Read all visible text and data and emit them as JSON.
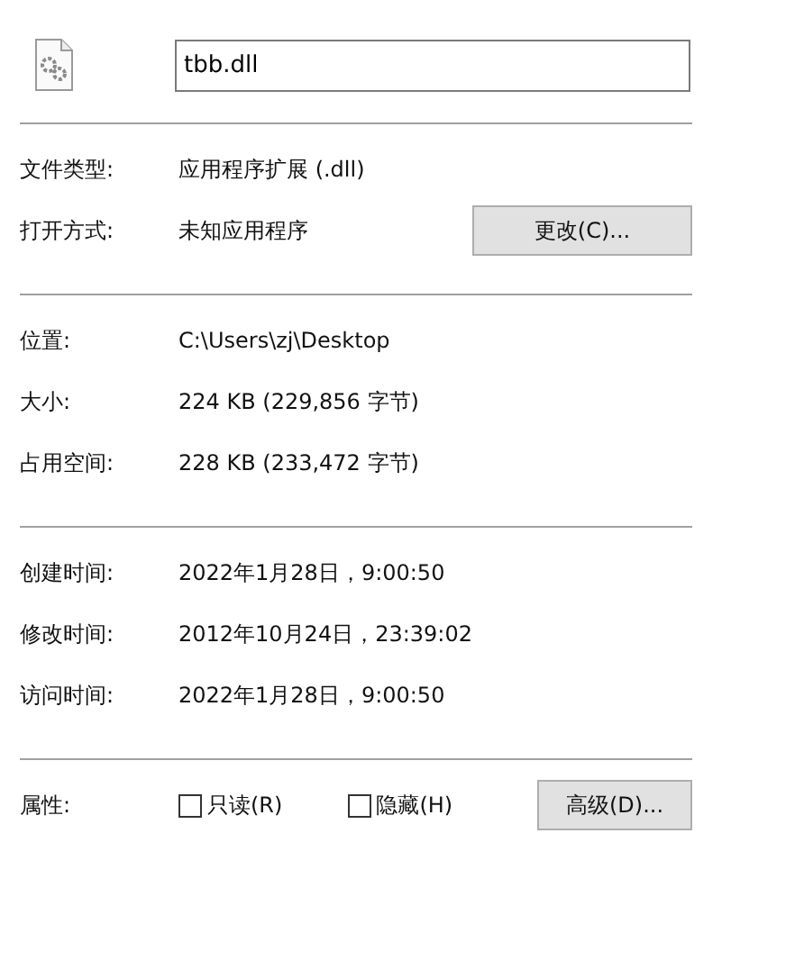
{
  "file_name": "tbb.dll",
  "type_rows": [
    {
      "label": "文件类型:",
      "value": "应用程序扩展 (.dll)"
    },
    {
      "label": "打开方式:",
      "value": "未知应用程序",
      "button": "更改(C)..."
    }
  ],
  "location_rows": [
    {
      "label": "位置:",
      "value": "C:\\Users\\zj\\Desktop"
    },
    {
      "label": "大小:",
      "value": "224 KB (229,856 字节)"
    },
    {
      "label": "占用空间:",
      "value": "228 KB (233,472 字节)"
    }
  ],
  "time_rows": [
    {
      "label": "创建时间:",
      "value": "2022年1月28日，9:00:50"
    },
    {
      "label": "修改时间:",
      "value": "2012年10月24日，23:39:02"
    },
    {
      "label": "访问时间:",
      "value": "2022年1月28日，9:00:50"
    }
  ],
  "attributes": {
    "label": "属性:",
    "options": [
      {
        "label": "只读(R)",
        "checked": false
      },
      {
        "label": "隐藏(H)",
        "checked": false
      }
    ],
    "button": "高级(D)..."
  }
}
